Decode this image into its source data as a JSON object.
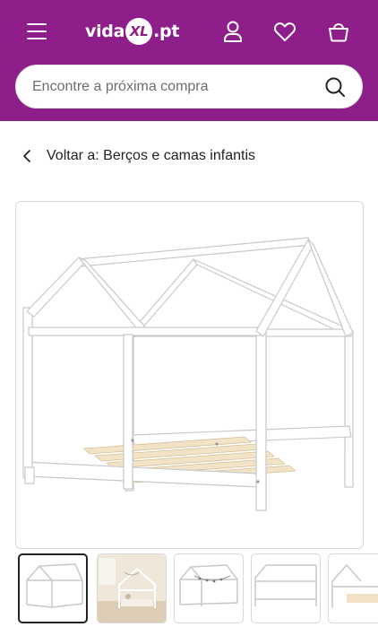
{
  "header": {
    "brand": {
      "prefix": "vida",
      "mark": "XL",
      "suffix": ".pt"
    },
    "icons": [
      "menu-icon",
      "account-icon",
      "heart-icon",
      "basket-icon"
    ],
    "accent_color": "#8e1f8a"
  },
  "search": {
    "placeholder": "Encontre a próxima compra",
    "value": ""
  },
  "breadcrumb": {
    "back_label": "Voltar a: Berços e camas infantis"
  },
  "gallery": {
    "main_image": "white-wooden-house-frame-bed",
    "thumbnails": [
      {
        "name": "bed-white-front",
        "selected": true
      },
      {
        "name": "bed-room-scene",
        "selected": false
      },
      {
        "name": "bed-with-decor",
        "selected": false
      },
      {
        "name": "bed-side-view",
        "selected": false
      },
      {
        "name": "bed-angle-view",
        "selected": false
      }
    ]
  }
}
